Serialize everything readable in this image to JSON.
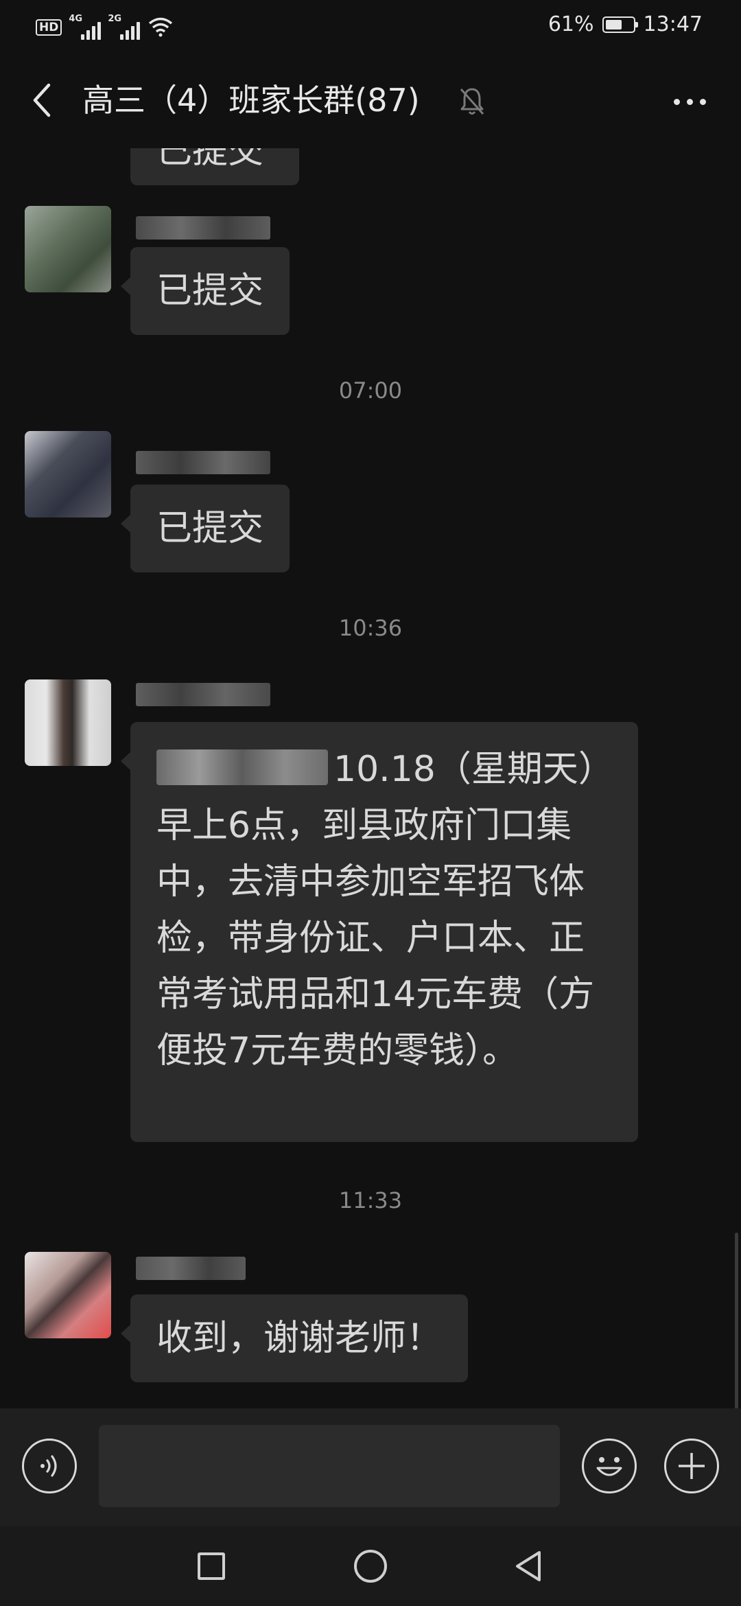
{
  "status_bar": {
    "hd_label": "HD",
    "network1": "4G",
    "network2": "2G",
    "battery_percent": "61%",
    "battery_level": 0.61,
    "time": "13:47"
  },
  "header": {
    "title": "高三（4）班家长群(87)",
    "back_icon": "back-arrow-icon",
    "mute_icon": "muted-bell-icon",
    "more_icon": "more-dots-icon"
  },
  "messages": {
    "partial_top_text": "已提交",
    "msg1_text": "已提交",
    "ts1": "07:00",
    "msg2_text": "已提交",
    "ts2": "10:36",
    "msg3_text": "10.18（星期天）早上6点，到县政府门口集中，去清中参加空军招飞体检，带身份证、户口本、正常考试用品和14元车费（方便投7元车费的零钱）。",
    "ts3": "11:33",
    "msg4_text": "收到，谢谢老师！"
  },
  "input_bar": {
    "voice_icon": "voice-icon",
    "input_value": "",
    "emoji_icon": "emoji-icon",
    "plus_icon": "plus-icon"
  },
  "nav_bar": {
    "recent_icon": "recent-apps-icon",
    "home_icon": "home-icon",
    "back_icon": "nav-back-icon"
  },
  "colors": {
    "background": "#111111",
    "bubble": "#2c2c2c",
    "text": "#d9d9d9",
    "timestamp": "#8a8a8a"
  }
}
